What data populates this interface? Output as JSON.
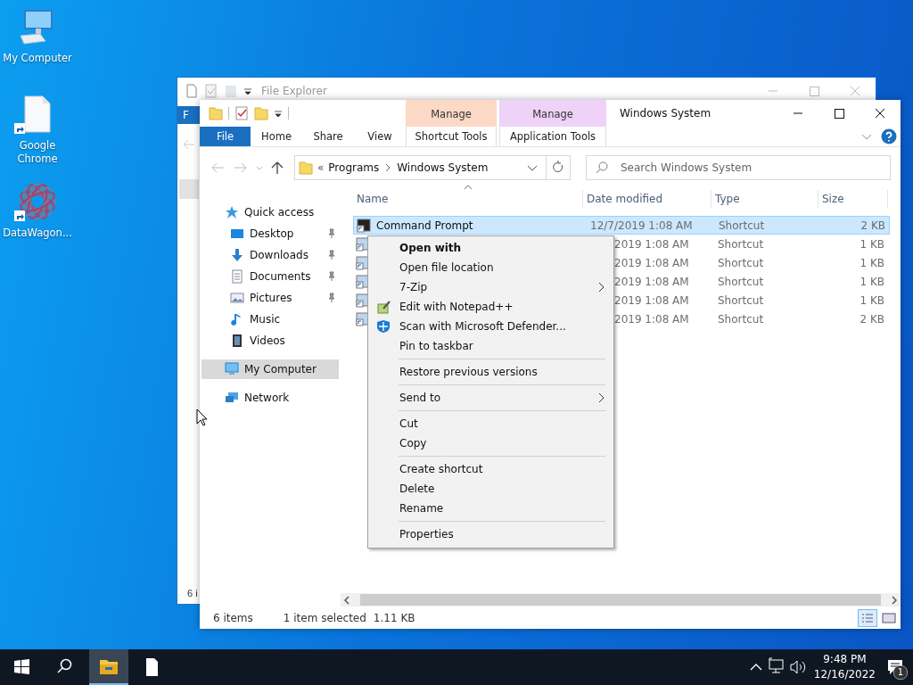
{
  "desktop": {
    "icons": [
      {
        "label": "My Computer",
        "kind": "computer",
        "shortcut": false
      },
      {
        "label": "Google Chrome",
        "kind": "blank",
        "shortcut": true
      },
      {
        "label": "DataWagon...",
        "kind": "emblem",
        "shortcut": true
      }
    ]
  },
  "back_window": {
    "title": "File Explorer",
    "tab_fragment": "F",
    "status_fragment": "6 i"
  },
  "window": {
    "title": "Windows System"
  },
  "ribbon": {
    "tabs": [
      {
        "label": "File",
        "kind": "file"
      },
      {
        "label": "Home",
        "kind": "plain"
      },
      {
        "label": "Share",
        "kind": "plain"
      },
      {
        "label": "View",
        "kind": "plain"
      }
    ],
    "contextual": [
      {
        "header": "Manage",
        "tab": "Shortcut Tools",
        "color": "#fcd9c6"
      },
      {
        "header": "Manage",
        "tab": "Application Tools",
        "color": "#eed2f8"
      }
    ]
  },
  "address_bar": {
    "overflow": "«",
    "path": [
      "Programs",
      "Windows System"
    ],
    "search_placeholder": "Search Windows System"
  },
  "nav_pane": {
    "items": [
      {
        "label": "Quick access",
        "kind": "star",
        "selected": false,
        "children": [
          {
            "label": "Desktop",
            "kind": "desktop",
            "pinned": true,
            "selected": false
          },
          {
            "label": "Downloads",
            "kind": "download",
            "pinned": true,
            "selected": false
          },
          {
            "label": "Documents",
            "kind": "document",
            "pinned": true,
            "selected": false
          },
          {
            "label": "Pictures",
            "kind": "pictures",
            "pinned": true,
            "selected": false
          },
          {
            "label": "Music",
            "kind": "music",
            "pinned": false,
            "selected": false
          },
          {
            "label": "Videos",
            "kind": "videos",
            "pinned": false,
            "selected": false
          }
        ]
      },
      {
        "label": "My Computer",
        "kind": "computer",
        "selected": true
      },
      {
        "label": "Network",
        "kind": "network",
        "selected": false
      }
    ]
  },
  "file_list": {
    "columns": [
      "Name",
      "Date modified",
      "Type",
      "Size"
    ],
    "rows": [
      {
        "name": "Command Prompt",
        "date_modified": "12/7/2019 1:08 AM",
        "type": "Shortcut",
        "size": "2 KB",
        "selected": true
      },
      {
        "date_modified": "2019 1:08 AM",
        "type": "Shortcut",
        "size": "1 KB",
        "selected": false
      },
      {
        "date_modified": "2019 1:08 AM",
        "type": "Shortcut",
        "size": "1 KB",
        "selected": false
      },
      {
        "date_modified": "2019 1:08 AM",
        "type": "Shortcut",
        "size": "1 KB",
        "selected": false
      },
      {
        "date_modified": "2019 1:08 AM",
        "type": "Shortcut",
        "size": "1 KB",
        "selected": false
      },
      {
        "date_modified": "2019 1:08 AM",
        "type": "Shortcut",
        "size": "2 KB",
        "selected": false
      }
    ]
  },
  "context_menu": {
    "items": [
      {
        "kind": "plain",
        "label": "Open with",
        "default": true
      },
      {
        "kind": "plain",
        "label": "Open file location",
        "default": false
      },
      {
        "kind": "submenu",
        "label": "7-Zip",
        "default": false
      },
      {
        "kind": "editor",
        "label": "Edit with Notepad++",
        "default": false
      },
      {
        "kind": "shield",
        "label": "Scan with Microsoft Defender...",
        "default": false
      },
      {
        "kind": "plain",
        "label": "Pin to taskbar",
        "default": false
      },
      {
        "kind": "separator"
      },
      {
        "kind": "plain",
        "label": "Restore previous versions",
        "default": false
      },
      {
        "kind": "separator"
      },
      {
        "kind": "submenu",
        "label": "Send to",
        "default": false
      },
      {
        "kind": "separator"
      },
      {
        "kind": "plain",
        "label": "Cut",
        "default": false
      },
      {
        "kind": "plain",
        "label": "Copy",
        "default": false
      },
      {
        "kind": "separator"
      },
      {
        "kind": "plain",
        "label": "Create shortcut",
        "default": false
      },
      {
        "kind": "plain",
        "label": "Delete",
        "default": false
      },
      {
        "kind": "plain",
        "label": "Rename",
        "default": false
      },
      {
        "kind": "separator"
      },
      {
        "kind": "plain",
        "label": "Properties",
        "default": false
      }
    ]
  },
  "status_bar": {
    "item_count": "6 items",
    "selection": "1 item selected",
    "selection_size": "1.11 KB",
    "views": [
      {
        "kind": "details",
        "selected": true
      },
      {
        "kind": "tiles",
        "selected": false
      }
    ]
  },
  "taskbar": {
    "apps": [
      {
        "kind": "explorer",
        "active": true
      },
      {
        "kind": "document",
        "active": false
      }
    ],
    "clock": {
      "time": "9:48 PM",
      "date": "12/16/2022"
    },
    "notification_count": "1"
  }
}
